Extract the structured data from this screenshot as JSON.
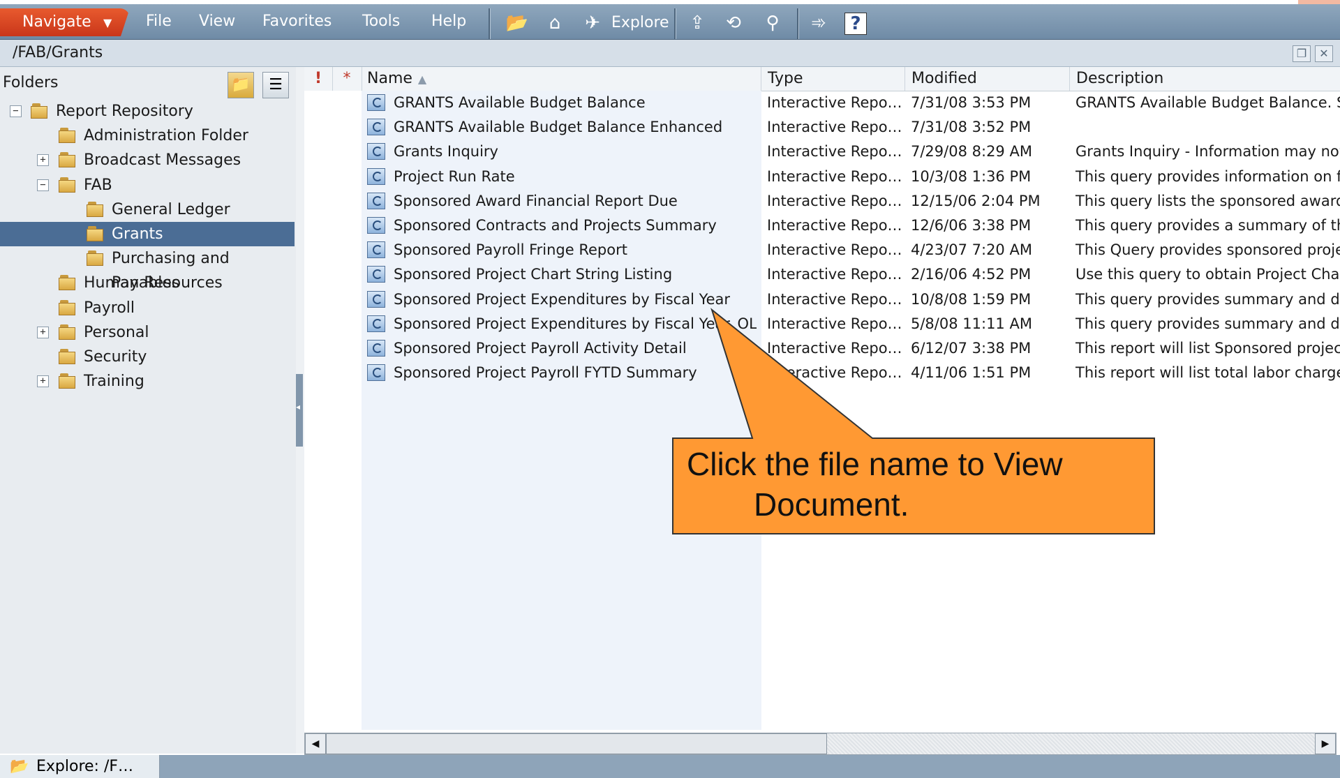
{
  "menubar": {
    "navigate_label": "Navigate",
    "items": [
      "File",
      "View",
      "Favorites",
      "Tools",
      "Help"
    ],
    "explore_label": "Explore"
  },
  "pathbar": {
    "path": "/FAB/Grants"
  },
  "sidebar": {
    "title": "Folders",
    "tree": [
      {
        "label": "Report Repository",
        "level": 0,
        "toggle": "−"
      },
      {
        "label": "Administration Folder",
        "level": 1,
        "toggle": ""
      },
      {
        "label": "Broadcast Messages",
        "level": 1,
        "toggle": "+"
      },
      {
        "label": "FAB",
        "level": 1,
        "toggle": "−"
      },
      {
        "label": "General Ledger",
        "level": 2,
        "toggle": ""
      },
      {
        "label": "Grants",
        "level": 2,
        "toggle": "",
        "selected": true
      },
      {
        "label": "Purchasing and Payables",
        "level": 2,
        "toggle": ""
      },
      {
        "label": "Human Resources",
        "level": 1,
        "toggle": ""
      },
      {
        "label": "Payroll",
        "level": 1,
        "toggle": ""
      },
      {
        "label": "Personal",
        "level": 1,
        "toggle": "+"
      },
      {
        "label": "Security",
        "level": 1,
        "toggle": ""
      },
      {
        "label": "Training",
        "level": 1,
        "toggle": "+"
      }
    ]
  },
  "list": {
    "columns": {
      "flag": "!",
      "star": "*",
      "name": "Name",
      "sort_indicator": "▲",
      "type": "Type",
      "modified": "Modified",
      "description": "Description"
    },
    "rows": [
      {
        "name": "GRANTS Available Budget Balance",
        "type": "Interactive Repo…",
        "modified": "7/31/08 3:53 PM",
        "description": "GRANTS Available Budget Balance.  Se"
      },
      {
        "name": "GRANTS Available Budget Balance Enhanced",
        "type": "Interactive Repo…",
        "modified": "7/31/08 3:52 PM",
        "description": ""
      },
      {
        "name": "Grants Inquiry",
        "type": "Interactive Repo…",
        "modified": "7/29/08 8:29 AM",
        "description": "Grants Inquiry - Information may now"
      },
      {
        "name": "Project Run Rate",
        "type": "Interactive Repo…",
        "modified": "10/3/08 1:36 PM",
        "description": "This query provides information on fina"
      },
      {
        "name": "Sponsored Award Financial Report Due",
        "type": "Interactive Repo…",
        "modified": "12/15/06 2:04 PM",
        "description": "This query lists the sponsored awards"
      },
      {
        "name": "Sponsored Contracts and Projects Summary",
        "type": "Interactive Repo…",
        "modified": "12/6/06 3:38 PM",
        "description": "This query provides a summary of the"
      },
      {
        "name": "Sponsored Payroll Fringe Report",
        "type": "Interactive Repo…",
        "modified": "4/23/07 7:20 AM",
        "description": "This Query provides sponsored project"
      },
      {
        "name": "Sponsored Project Chart String Listing",
        "type": "Interactive Repo…",
        "modified": "2/16/06 4:52 PM",
        "description": "Use this query to obtain Project Chart:"
      },
      {
        "name": "Sponsored Project Expenditures by Fiscal Year",
        "type": "Interactive Repo…",
        "modified": "10/8/08 1:59 PM",
        "description": "This query provides summary and deta"
      },
      {
        "name": "Sponsored Project Expenditures by Fiscal Year_OLD",
        "type": "Interactive Repo…",
        "modified": "5/8/08 11:11 AM",
        "description": "This query provides summary and deta"
      },
      {
        "name": "Sponsored Project Payroll Activity Detail",
        "type": "Interactive Repo…",
        "modified": "6/12/07 3:38 PM",
        "description": "This report will list Sponsored project F"
      },
      {
        "name": "Sponsored Project Payroll FYTD Summary",
        "type": "Interactive Repo…",
        "modified": "4/11/06 1:51 PM",
        "description": "This report will list total labor charges a"
      }
    ]
  },
  "statusbar": {
    "tab_label": "Explore: /F…"
  },
  "callout": {
    "line1": "Click the file name to View",
    "line2": "Document.",
    "fill": "#ff9933",
    "border": "#333333"
  },
  "colors": {
    "menubar": "#7b96b0",
    "navigate": "#d9441f",
    "selection": "#4b6d95"
  }
}
